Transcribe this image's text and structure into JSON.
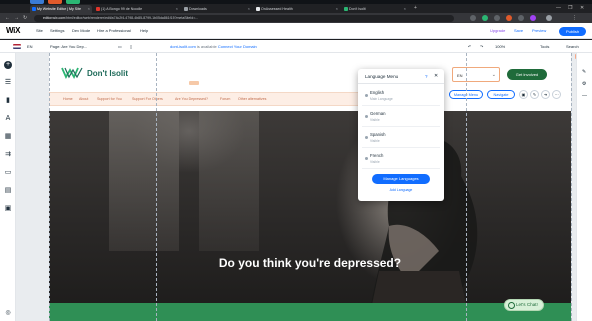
{
  "browser": {
    "tabs": [
      {
        "label": "My Website Editor | My Site"
      },
      {
        "label": "(1) A Bongo 99 de Noodle"
      },
      {
        "label": "Downloads"
      },
      {
        "label": "OnAssessed Health"
      },
      {
        "label": "Don't Isolit"
      }
    ],
    "url_host": "editor.wix.com",
    "url_rest": "/html/editor/web/renderer/edit/a74c2f4-4798-4b85-8799-1b05da861f15?metaSiteId=...",
    "window_controls": [
      "—",
      "❐",
      "✕"
    ]
  },
  "wix": {
    "logo": "WiX",
    "menu": [
      "Site",
      "Settings",
      "Dev Mode",
      "Hire a Professional",
      "Help"
    ],
    "right": {
      "upgrade": "Upgrade",
      "save": "Save",
      "preview": "Preview",
      "publish": "Publish"
    }
  },
  "toolbar2": {
    "language": "EN",
    "page": "Page: Are You Dep...",
    "domain": "dont-isolit.com",
    "domain_suffix": "is available",
    "connect": "Connect Your Domain",
    "zoom": "100%",
    "tools": "Tools",
    "search": "Search"
  },
  "site": {
    "brand": "Don't Isolit",
    "nav": [
      "Home",
      "About",
      "Support for You",
      "Support For Others",
      "Are You Depressed?",
      "Forum",
      "Other alternatives"
    ],
    "get_help": "Get Involved",
    "lang_select": "EN",
    "manage_menu": "Manage Menu",
    "navigate": "Navigate",
    "hero_title": "Do you think you're depressed?",
    "chat": "Let's Chat!"
  },
  "language_menu": {
    "title": "Language Menu",
    "help": "?",
    "close": "✕",
    "items": [
      {
        "name": "English",
        "sub": "Main Language"
      },
      {
        "name": "German",
        "sub": "Visible"
      },
      {
        "name": "Spanish",
        "sub": "Visible"
      },
      {
        "name": "French",
        "sub": "Visible"
      }
    ],
    "manage": "Manage Languages",
    "add": "Add Language"
  },
  "colors": {
    "accent": "#116dff",
    "brand_green": "#1f6b3a",
    "nav_peach": "#fdeee5",
    "chat_bg": "#d8f0d8"
  }
}
